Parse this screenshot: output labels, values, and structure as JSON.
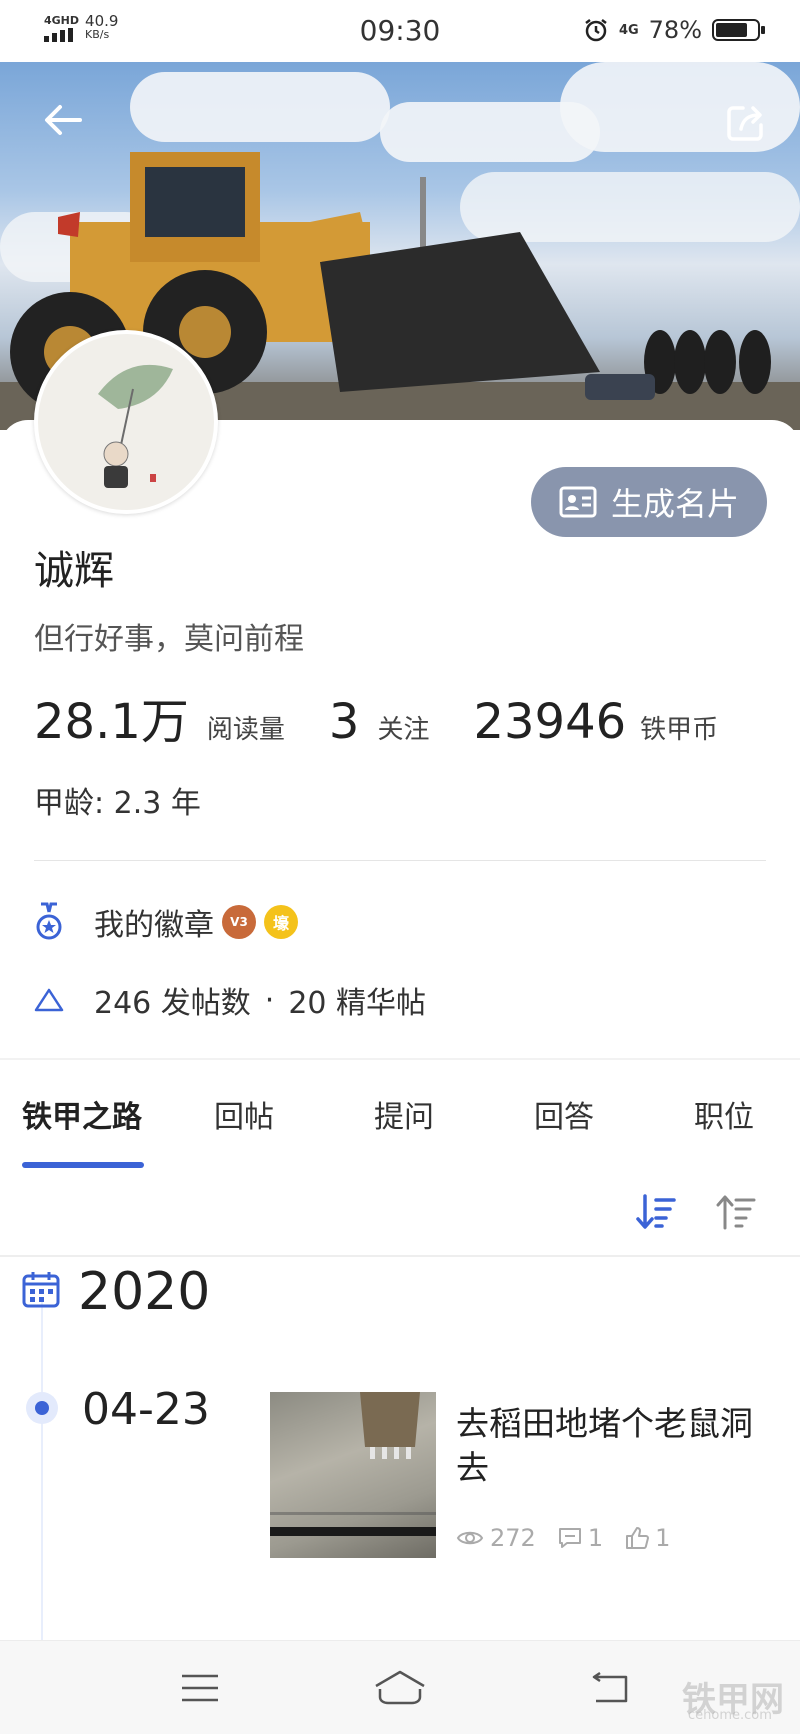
{
  "status_bar": {
    "network_label": "4GHD",
    "speed_value": "40.9",
    "speed_unit": "KB/s",
    "time": "09:30",
    "signal_label": "4G",
    "battery_percent": "78%",
    "battery_level": 0.78
  },
  "profile": {
    "name": "诚辉",
    "motto": "但行好事，莫问前程",
    "generate_card_label": "生成名片",
    "stats": [
      {
        "value": "28.1万",
        "label": "阅读量"
      },
      {
        "value": "3",
        "label": "关注"
      },
      {
        "value": "23946",
        "label": "铁甲币"
      }
    ],
    "age_text": "甲龄: 2.3 年",
    "badges_label": "我的徽章",
    "badge_v3": "V3",
    "badge_coin": "壕",
    "post_count": "246 发帖数",
    "separator": "·",
    "featured_count": "20 精华帖"
  },
  "tabs": [
    {
      "label": "铁甲之路",
      "active": true
    },
    {
      "label": "回帖",
      "active": false
    },
    {
      "label": "提问",
      "active": false
    },
    {
      "label": "回答",
      "active": false
    },
    {
      "label": "职位",
      "active": false
    }
  ],
  "timeline": {
    "year": "2020",
    "entries": [
      {
        "date": "04-23",
        "title": "去稻田地堵个老鼠洞去",
        "views": "272",
        "comments": "1",
        "likes": "1"
      }
    ]
  },
  "watermark": {
    "text": "铁甲网",
    "sub": "cehome.com"
  },
  "colors": {
    "accent": "#3b63d6",
    "card_button": "#8995ad"
  }
}
